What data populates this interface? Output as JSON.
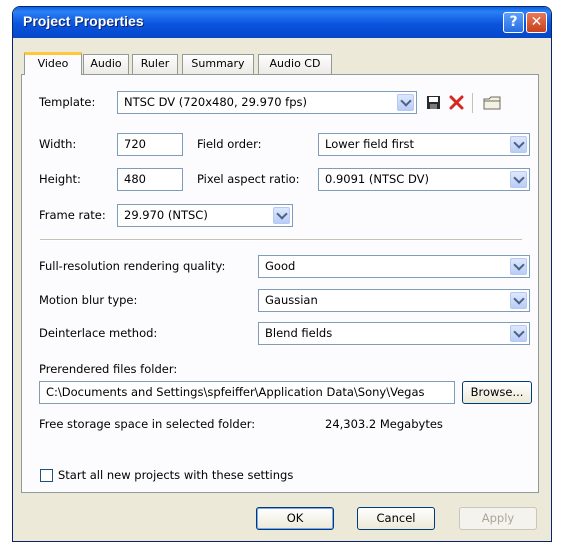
{
  "window": {
    "title": "Project Properties",
    "help_glyph": "?",
    "close_glyph": "✕"
  },
  "tabs": [
    {
      "label": "Video"
    },
    {
      "label": "Audio"
    },
    {
      "label": "Ruler"
    },
    {
      "label": "Summary"
    },
    {
      "label": "Audio CD"
    }
  ],
  "video": {
    "template_label": "Template:",
    "template_value": "NTSC DV (720x480, 29.970 fps)",
    "width_label": "Width:",
    "width_value": "720",
    "height_label": "Height:",
    "height_value": "480",
    "field_order_label": "Field order:",
    "field_order_value": "Lower field first",
    "par_label": "Pixel aspect ratio:",
    "par_value": "0.9091 (NTSC DV)",
    "frame_rate_label": "Frame rate:",
    "frame_rate_value": "29.970 (NTSC)",
    "render_quality_label": "Full-resolution rendering quality:",
    "render_quality_value": "Good",
    "motion_blur_label": "Motion blur type:",
    "motion_blur_value": "Gaussian",
    "deinterlace_label": "Deinterlace method:",
    "deinterlace_value": "Blend fields",
    "prerender_label": "Prerendered files folder:",
    "prerender_value": "C:\\Documents and Settings\\spfeiffer\\Application Data\\Sony\\Vegas",
    "browse_label": "Browse...",
    "free_space_label": "Free storage space in selected folder:",
    "free_space_value": "24,303.2 Megabytes",
    "start_new_label": "Start all new projects with these settings",
    "start_new_checked": false
  },
  "buttons": {
    "ok": "OK",
    "cancel": "Cancel",
    "apply": "Apply"
  },
  "icons": {
    "save": "save-icon",
    "delete": "delete-icon",
    "folder": "folder-icon"
  },
  "colors": {
    "titlebar": "#0a54de",
    "tab_highlight": "#ffc83c",
    "delete_red": "#d9261c"
  }
}
